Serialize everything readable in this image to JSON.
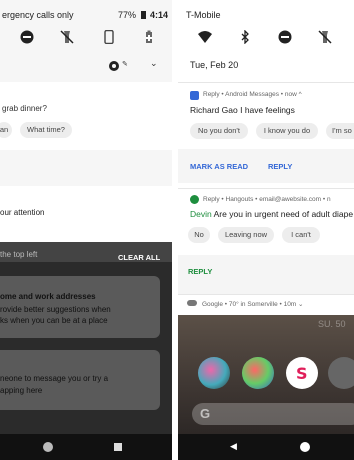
{
  "left": {
    "status_text": "ergency calls only",
    "battery": "77%",
    "time": "4:14",
    "msg_preview": "grab dinner?",
    "chip1": "an",
    "chip2": "What time?",
    "attention": "our attention",
    "top_left": "the top left",
    "clear_all": "CLEAR ALL",
    "card1_title": "ome and work addresses",
    "card1_line1": "rovide better suggestions when",
    "card1_line2": "ks when you can be at a place",
    "card2_line1": "neone to message you or try a",
    "card2_line2": "apping here"
  },
  "right": {
    "carrier": "T-Mobile",
    "date": "Tue, Feb 20",
    "notif1_header": "Reply • Android Messages • now ^",
    "notif1_sender": "Richard Gao",
    "notif1_text": "I have feelings",
    "notif1_chips": [
      "No you don't",
      "I know you do",
      "I'm so"
    ],
    "mark_as_read": "MARK AS READ",
    "reply1": "REPLY",
    "notif2_header": "Reply • Hangouts • email@awebsite.com • n",
    "notif2_sender": "Devin",
    "notif2_text": "Are you in urgent need of adult diape",
    "notif2_chips": [
      "No",
      "Leaving now",
      "I can't"
    ],
    "reply2": "REPLY",
    "weather": "Google • 70° in Somerville • 10m ⌄",
    "clock_ghost": "SU. 50"
  },
  "colors": {
    "blue": "#3367d6",
    "green": "#1e8e3e",
    "dark_bg": "#2b2b2b"
  }
}
